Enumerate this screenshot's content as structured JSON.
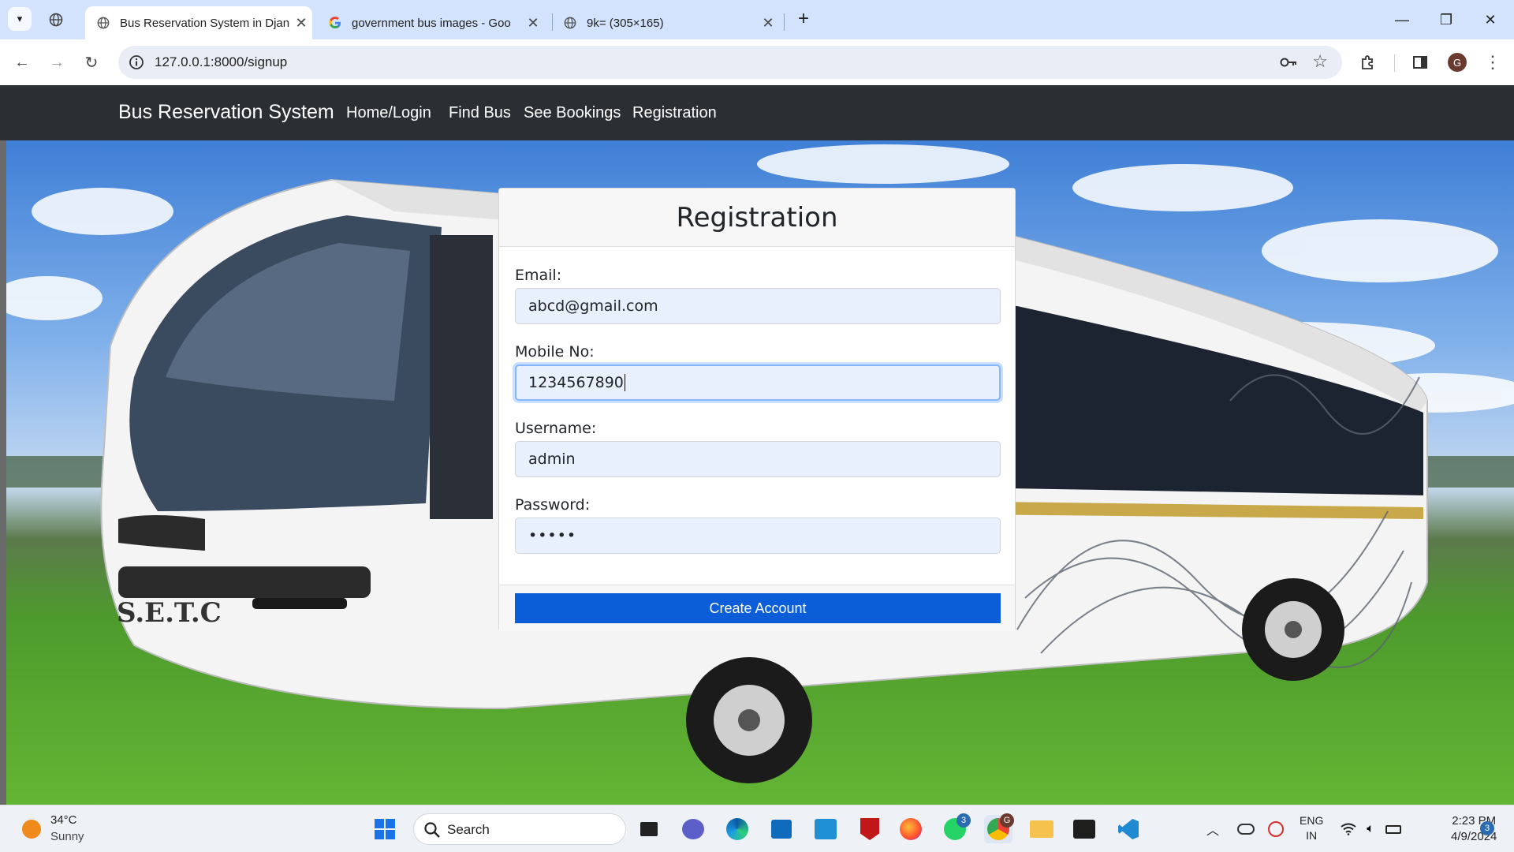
{
  "browser": {
    "tabs": [
      {
        "title": "Bus Reservation System in Djan",
        "active": true
      },
      {
        "title": "government bus images - Goo",
        "active": false
      },
      {
        "title": "9k= (305×165)",
        "active": false
      }
    ],
    "url": "127.0.0.1:8000/signup",
    "profile_initial": "G"
  },
  "navbar": {
    "brand": "Bus Reservation System",
    "links": [
      "Home/Login",
      "Find Bus",
      "See Bookings",
      "Registration"
    ]
  },
  "form": {
    "title": "Registration",
    "fields": [
      {
        "label": "Email:",
        "value": "abcd@gmail.com"
      },
      {
        "label": "Mobile No:",
        "value": "1234567890"
      },
      {
        "label": "Username:",
        "value": "admin"
      },
      {
        "label": "Password:",
        "value": "•••••"
      }
    ],
    "submit_label": "Create Account"
  },
  "bus_livery": {
    "text": "S.E.T.C"
  },
  "taskbar": {
    "weather_temp": "34°C",
    "weather_condition": "Sunny",
    "search_label": "Search",
    "whatsapp_badge": "3",
    "chrome_badge": "G",
    "lang_line1": "ENG",
    "lang_line2": "IN",
    "time": "2:23 PM",
    "date": "4/9/2024",
    "notification_count": "3"
  }
}
